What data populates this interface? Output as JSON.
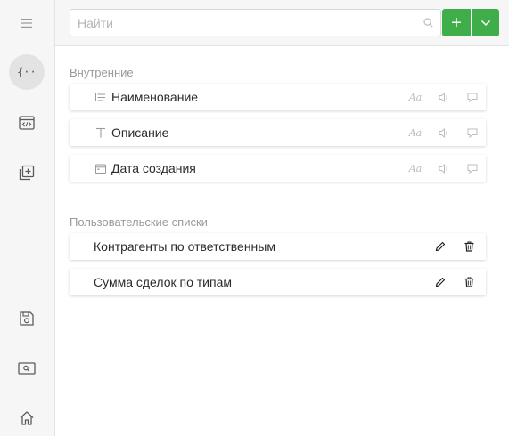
{
  "search": {
    "placeholder": "Найти",
    "value": ""
  },
  "toolbar": {
    "add_label": "+"
  },
  "sections": {
    "internal": {
      "title": "Внутренние",
      "items": [
        {
          "label": "Наименование",
          "icon": "text-lines-icon",
          "aa": "Aa"
        },
        {
          "label": "Описание",
          "icon": "text-t-icon",
          "aa": "Aa"
        },
        {
          "label": "Дата создания",
          "icon": "calendar-icon",
          "aa": "Aa"
        }
      ]
    },
    "custom": {
      "title": "Пользовательские списки",
      "items": [
        {
          "label": "Контрагенты по ответственным"
        },
        {
          "label": "Сумма сделок по типам"
        }
      ]
    }
  },
  "colors": {
    "accent": "#3fae4a",
    "rail_bg": "#f6f6f6",
    "muted_text": "#9a9a9a"
  }
}
